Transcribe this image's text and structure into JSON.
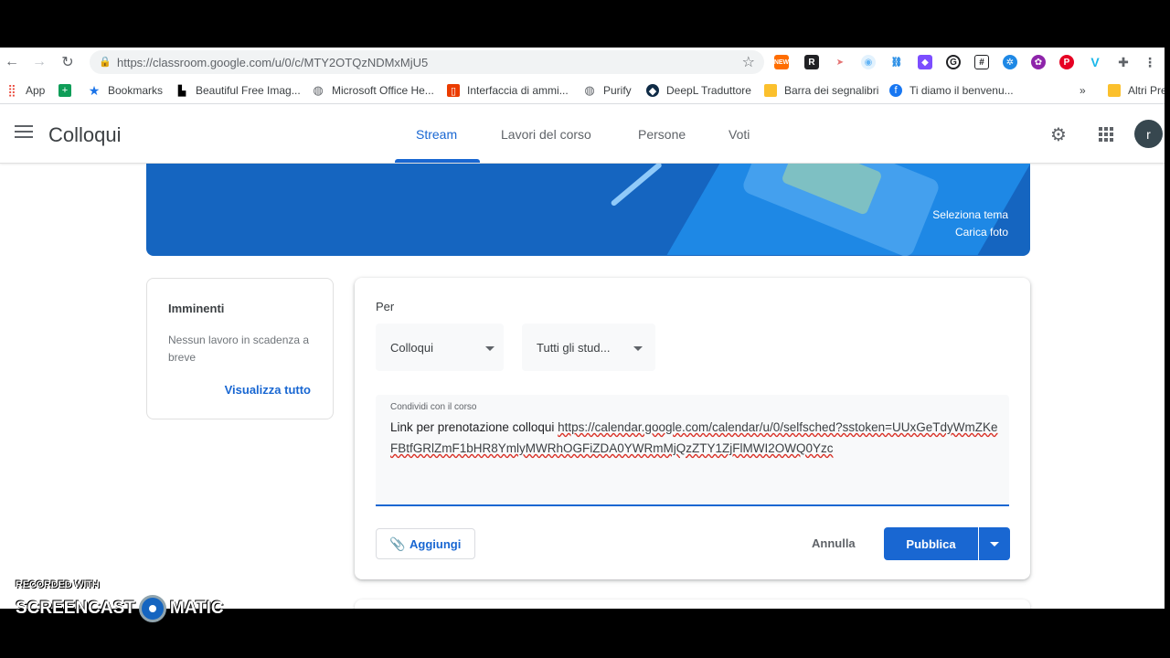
{
  "browser": {
    "url": "https://classroom.google.com/u/0/c/MTY2OTQzNDMxMjU5",
    "bookmarks": [
      {
        "label": "App",
        "icon": "apps-grid-icon"
      },
      {
        "label": "",
        "icon": "sheets-icon"
      },
      {
        "label": "Bookmarks",
        "icon": "star-icon"
      },
      {
        "label": "Beautiful Free Imag...",
        "icon": "unsplash-icon"
      },
      {
        "label": "Microsoft Office He...",
        "icon": "globe-icon"
      },
      {
        "label": "Interfaccia di ammi...",
        "icon": "office-icon"
      },
      {
        "label": "Purify",
        "icon": "globe-icon"
      },
      {
        "label": "DeepL Traduttore",
        "icon": "deepl-icon"
      },
      {
        "label": "Barra dei segnalibri",
        "icon": "folder-icon"
      },
      {
        "label": "Ti diamo il benvenu...",
        "icon": "facebook-icon"
      },
      {
        "label": "»",
        "icon": "more-icon"
      },
      {
        "label": "Altri Pre",
        "icon": "folder-icon"
      }
    ],
    "extension_badge": "NEW",
    "extension_letter": "R"
  },
  "header": {
    "class_title": "Colloqui",
    "tabs": [
      {
        "label": "Stream",
        "active": true
      },
      {
        "label": "Lavori del corso",
        "active": false
      },
      {
        "label": "Persone",
        "active": false
      },
      {
        "label": "Voti",
        "active": false
      }
    ],
    "avatar_letter": "r"
  },
  "banner": {
    "select_theme": "Seleziona tema",
    "upload_photo": "Carica foto"
  },
  "upcoming": {
    "title": "Imminenti",
    "body": "Nessun lavoro in scadenza a breve",
    "view_all": "Visualizza tutto"
  },
  "composer": {
    "for_label": "Per",
    "class_select": "Colloqui",
    "students_select": "Tutti gli stud...",
    "editor_label": "Condividi con il corso",
    "text_prefix": "Link per prenotazione colloqui ",
    "text_link": "https://calendar.google.com/calendar/u/0/selfsched?sstoken=UUxGeTdyWmZKeFBtfGRlZmF1bHR8YmlyMWRhOGFiZDA0YWRmMjQzZTY1ZjFlMWI2OWQ0Yzc",
    "attach_label": "Aggiungi",
    "cancel_label": "Annulla",
    "publish_label": "Pubblica"
  },
  "watermark": {
    "top": "RECORDED WITH",
    "left": "SCREENCAST",
    "right": "MATIC"
  },
  "colors": {
    "accent": "#1967d2",
    "banner": "#1565c0"
  }
}
